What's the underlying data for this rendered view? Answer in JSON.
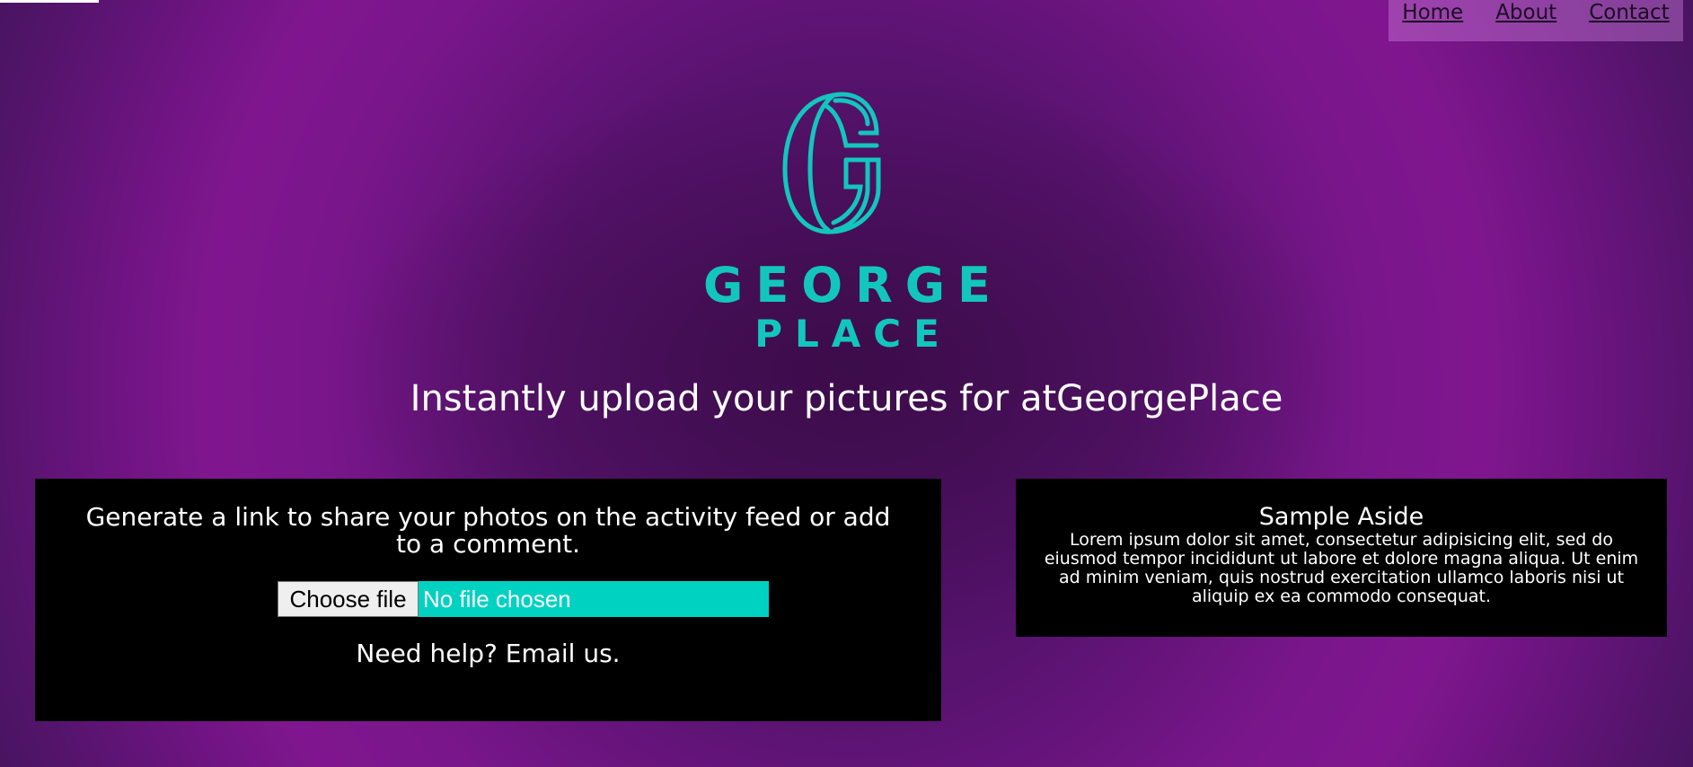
{
  "nav": {
    "home": "Home",
    "about": "About",
    "contact": "Contact"
  },
  "logo": {
    "line1": "GEORGE",
    "line2": "PLACE",
    "icon": "g-monogram-icon",
    "color": "#12c6bd"
  },
  "hero": {
    "tagline": "Instantly upload your pictures for atGeorgePlace"
  },
  "upload_panel": {
    "intro": "Generate a link to share your photos on the activity feed or add to a comment.",
    "choose_file_label": "Choose file",
    "file_status": "No file chosen",
    "help_text": "Need help? Email us."
  },
  "aside": {
    "title": "Sample Aside",
    "body": "Lorem ipsum dolor sit amet, consectetur adipisicing elit, sed do eiusmod tempor incididunt ut labore et dolore magna aliqua. Ut enim ad minim veniam, quis nostrud exercitation ullamco laboris nisi ut aliquip ex ea commodo consequat."
  },
  "colors": {
    "accent": "#00d2c1",
    "background_purple": "#7a168c",
    "panel": "#000000"
  }
}
